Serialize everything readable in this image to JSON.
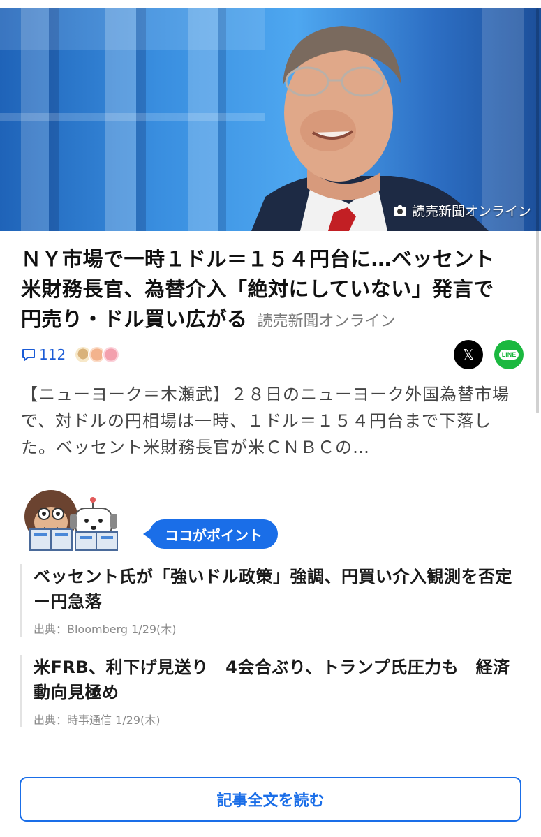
{
  "article": {
    "image_credit": "読売新聞オンライン",
    "headline": "ＮＹ市場で一時１ドル＝１５４円台に…ベッセント米財務長官、為替介入「絶対にしていない」発言で円売り・ドル買い広がる",
    "source": "読売新聞オンライン",
    "comment_count": "112",
    "summary": "【ニューヨーク＝木瀬武】２８日のニューヨーク外国為替市場で、対ドルの円相場は一時、１ドル＝１５４円台まで下落した。ベッセント米財務長官が米ＣＮＢＣの…"
  },
  "share": {
    "x_label": "𝕏",
    "line_label": "LINE"
  },
  "point": {
    "label": "ココがポイント",
    "items": [
      {
        "title": "ベッセント氏が「強いドル政策」強調、円買い介入観測を否定ー円急落",
        "source": "出典：Bloomberg 1/29(木)"
      },
      {
        "title": "米FRB、利下げ見送り　4会合ぶり、トランプ氏圧力も　経済動向見極め",
        "source": "出典：時事通信 1/29(木)"
      }
    ]
  },
  "read_full": {
    "label": "記事全文を読む"
  },
  "colors": {
    "accent": "#1a6ee8",
    "line_green": "#1bb83f",
    "comment_blue": "#1a5bd6"
  }
}
